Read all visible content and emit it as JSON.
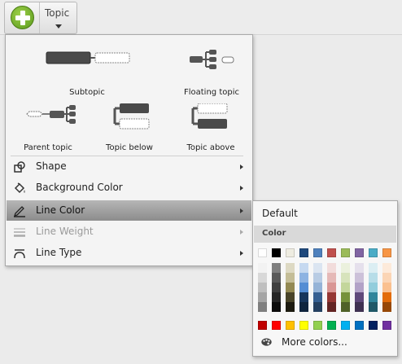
{
  "toolbar": {
    "add_icon": "add-topic-icon",
    "topic_button_label": "Topic"
  },
  "menu": {
    "tiles": [
      {
        "label": "Subtopic",
        "icon": "subtopic-icon"
      },
      {
        "label": "Floating topic",
        "icon": "floating-topic-icon"
      },
      {
        "label": "Parent topic",
        "icon": "parent-topic-icon"
      },
      {
        "label": "Topic below",
        "icon": "topic-below-icon"
      },
      {
        "label": "Topic above",
        "icon": "topic-above-icon"
      }
    ],
    "items": [
      {
        "label": "Shape",
        "icon": "shape-icon",
        "has_submenu": true,
        "state": "normal"
      },
      {
        "label": "Background Color",
        "icon": "paint-bucket-icon",
        "has_submenu": true,
        "state": "normal"
      },
      {
        "label": "Line Color",
        "icon": "pen-icon",
        "has_submenu": true,
        "state": "active"
      },
      {
        "label": "Line Weight",
        "icon": "line-weight-icon",
        "has_submenu": true,
        "state": "disabled"
      },
      {
        "label": "Line Type",
        "icon": "line-type-icon",
        "has_submenu": true,
        "state": "normal"
      }
    ]
  },
  "submenu": {
    "default_label": "Default",
    "header_label": "Color",
    "more_colors_label": "More colors...",
    "more_colors_icon": "palette-icon",
    "top_row": [
      "#ffffff",
      "#000000",
      "#eeece1",
      "#1f497d",
      "#4f81bd",
      "#c0504d",
      "#9bbb59",
      "#8064a2",
      "#4bacc6",
      "#f79646"
    ],
    "tint_columns": [
      [
        "#f2f2f2",
        "#d8d8d8",
        "#bfbfbf",
        "#a5a5a5",
        "#7f7f7f"
      ],
      [
        "#7f7f7f",
        "#595959",
        "#3f3f3f",
        "#262626",
        "#0c0c0c"
      ],
      [
        "#ddd9c3",
        "#c4bd97",
        "#938953",
        "#494429",
        "#1d1b10"
      ],
      [
        "#c6d9f0",
        "#8db3e2",
        "#548dd4",
        "#17365d",
        "#0f243e"
      ],
      [
        "#dbe5f1",
        "#b8cce4",
        "#95b3d7",
        "#366092",
        "#244061"
      ],
      [
        "#f2dcdb",
        "#e5b9b7",
        "#d99694",
        "#953734",
        "#632423"
      ],
      [
        "#ebf1dd",
        "#d7e3bc",
        "#c3d69b",
        "#76923c",
        "#4f6128"
      ],
      [
        "#e5e0ec",
        "#ccc1d9",
        "#b2a2c7",
        "#5f497a",
        "#3f3151"
      ],
      [
        "#dbeef3",
        "#b7dde8",
        "#92cddc",
        "#31859b",
        "#205867"
      ],
      [
        "#fdeada",
        "#fbd5b5",
        "#fac08f",
        "#e36c09",
        "#974806"
      ]
    ],
    "standard_row": [
      "#c00000",
      "#ff0000",
      "#ffc000",
      "#ffff00",
      "#92d050",
      "#00b050",
      "#00b0f0",
      "#0070c0",
      "#002060",
      "#7030a0"
    ]
  }
}
